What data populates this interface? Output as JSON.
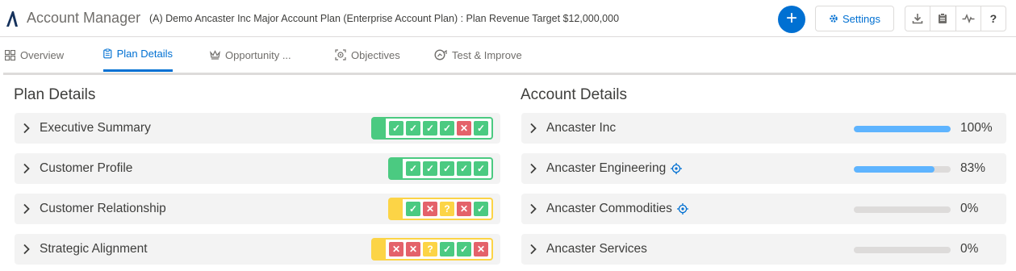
{
  "header": {
    "app_title": "Account Manager",
    "plan_title": "(A) Demo Ancaster Inc Major Account Plan (Enterprise Account Plan) : Plan Revenue Target $12,000,000",
    "add_label": "+",
    "settings_label": "Settings",
    "help_label": "?",
    "icons": [
      "download-icon",
      "clipboard-icon",
      "pulse-icon"
    ]
  },
  "tabs": [
    {
      "label": "Overview",
      "icon": "grid-icon",
      "active": false
    },
    {
      "label": "Plan Details",
      "icon": "clipboard-icon",
      "active": true
    },
    {
      "label": "Opportunity ...",
      "icon": "crown-icon",
      "active": false
    },
    {
      "label": "Objectives",
      "icon": "target-icon",
      "active": false
    },
    {
      "label": "Test & Improve",
      "icon": "gauge-icon",
      "active": false
    }
  ],
  "plan_details": {
    "title": "Plan Details",
    "rows": [
      {
        "label": "Executive Summary",
        "tone": "green",
        "checks": [
          "ok",
          "ok",
          "ok",
          "ok",
          "no",
          "ok"
        ]
      },
      {
        "label": "Customer Profile",
        "tone": "green",
        "checks": [
          "ok",
          "ok",
          "ok",
          "ok",
          "ok"
        ]
      },
      {
        "label": "Customer Relationship",
        "tone": "yellow",
        "checks": [
          "ok",
          "no",
          "q",
          "no",
          "ok"
        ]
      },
      {
        "label": "Strategic Alignment",
        "tone": "yellow",
        "checks": [
          "no",
          "no",
          "q",
          "ok",
          "ok",
          "no"
        ]
      }
    ]
  },
  "account_details": {
    "title": "Account Details",
    "rows": [
      {
        "label": "Ancaster Inc",
        "percent_text": "100%",
        "progress": 100,
        "target": false
      },
      {
        "label": "Ancaster Engineering",
        "percent_text": "83%",
        "progress": 83,
        "target": true
      },
      {
        "label": "Ancaster Commodities",
        "percent_text": "0%",
        "progress": 0,
        "target": true
      },
      {
        "label": "Ancaster Services",
        "percent_text": "0%",
        "progress": 0,
        "target": false
      }
    ]
  },
  "colors": {
    "brand": "#0070d2",
    "ok": "#4bca81",
    "fail": "#e4626a",
    "warn": "#fcd446",
    "progress": "#5eb4ff"
  }
}
